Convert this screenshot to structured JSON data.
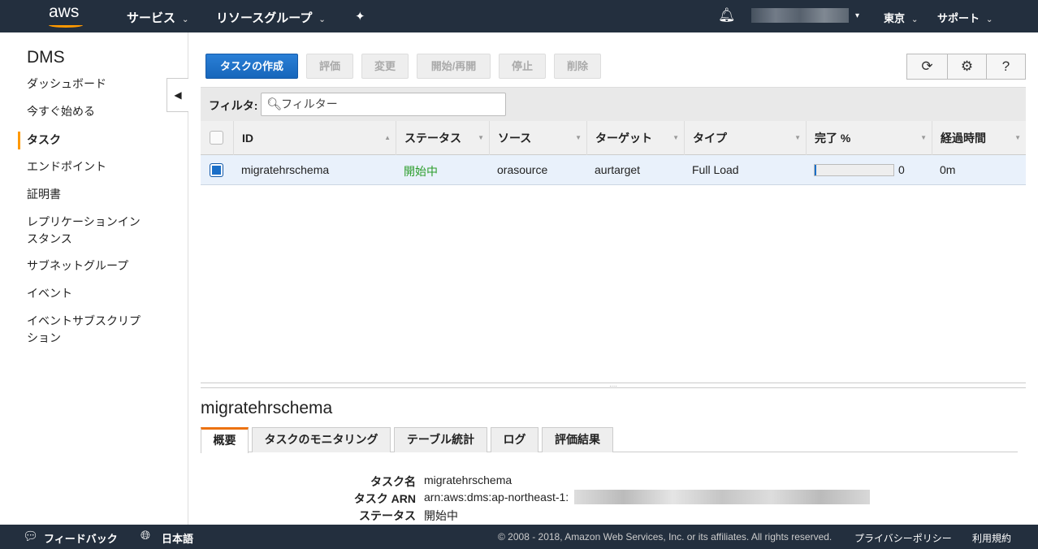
{
  "header": {
    "logo": "aws",
    "services": "サービス",
    "resource_groups": "リソースグループ",
    "region": "東京",
    "support": "サポート"
  },
  "sidebar": {
    "title": "DMS",
    "items": [
      "ダッシュボード",
      "今すぐ始める",
      "タスク",
      "エンドポイント",
      "証明書",
      "レプリケーションインスタンス",
      "サブネットグループ",
      "イベント",
      "イベントサブスクリプション"
    ]
  },
  "toolbar": {
    "create": "タスクの作成",
    "assess": "評価",
    "modify": "変更",
    "start": "開始/再開",
    "stop": "停止",
    "delete": "削除"
  },
  "filter": {
    "label": "フィルタ:",
    "placeholder": "フィルター"
  },
  "table": {
    "columns": [
      "ID",
      "ステータス",
      "ソース",
      "ターゲット",
      "タイプ",
      "完了 %",
      "経過時間"
    ],
    "rows": [
      {
        "id": "migratehrschema",
        "status": "開始中",
        "source": "orasource",
        "target": "aurtarget",
        "type": "Full Load",
        "progress": 0,
        "progress_label": "0",
        "elapsed": "0m"
      }
    ]
  },
  "detail": {
    "title": "migratehrschema",
    "tabs": [
      "概要",
      "タスクのモニタリング",
      "テーブル統計",
      "ログ",
      "評価結果"
    ],
    "fields": [
      {
        "key": "タスク名",
        "value": "migratehrschema"
      },
      {
        "key": "タスク ARN",
        "value": "arn:aws:dms:ap-northeast-1:"
      },
      {
        "key": "ステータス",
        "value": "開始中"
      }
    ]
  },
  "footer": {
    "feedback": "フィードバック",
    "language": "日本語",
    "copyright": "© 2008 - 2018, Amazon Web Services, Inc. or its affiliates. All rights reserved.",
    "privacy": "プライバシーポリシー",
    "terms": "利用規約"
  },
  "colors": {
    "accent": "#ec7211",
    "primary": "#1b6fc8",
    "status_green": "#2a9d2a",
    "header_bg": "#232f3e"
  }
}
